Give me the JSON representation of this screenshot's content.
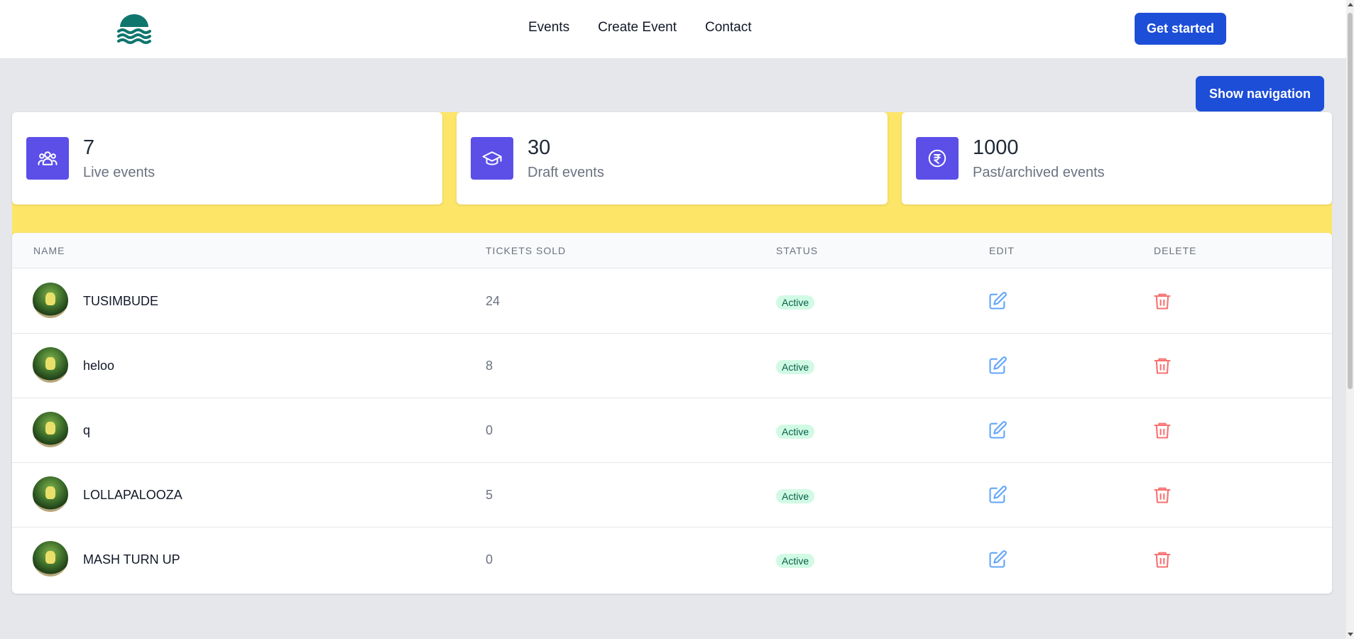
{
  "header": {
    "nav": [
      "Events",
      "Create Event",
      "Contact"
    ],
    "cta_label": "Get started"
  },
  "toolbar": {
    "show_nav_label": "Show navigation"
  },
  "stats": [
    {
      "value": "7",
      "label": "Live events",
      "icon": "users-icon"
    },
    {
      "value": "30",
      "label": "Draft events",
      "icon": "graduation-cap-icon"
    },
    {
      "value": "1000",
      "label": "Past/archived events",
      "icon": "rupee-icon"
    }
  ],
  "table": {
    "headers": {
      "name": "NAME",
      "tickets": "TICKETS SOLD",
      "status": "STATUS",
      "edit": "EDIT",
      "delete": "DELETE"
    },
    "rows": [
      {
        "name": "TUSIMBUDE",
        "tickets": "24",
        "status": "Active"
      },
      {
        "name": "heloo",
        "tickets": "8",
        "status": "Active"
      },
      {
        "name": "q",
        "tickets": "0",
        "status": "Active"
      },
      {
        "name": "LOLLAPALOOZA",
        "tickets": "5",
        "status": "Active"
      },
      {
        "name": "MASH TURN UP",
        "tickets": "0",
        "status": "Active"
      }
    ]
  },
  "colors": {
    "primary": "#1d4ed8",
    "stat_icon_bg": "#5b4fe8",
    "panel_yellow": "#fde568",
    "status_bg": "#d1fae5",
    "edit_icon": "#60a5fa",
    "delete_icon": "#f87171"
  }
}
